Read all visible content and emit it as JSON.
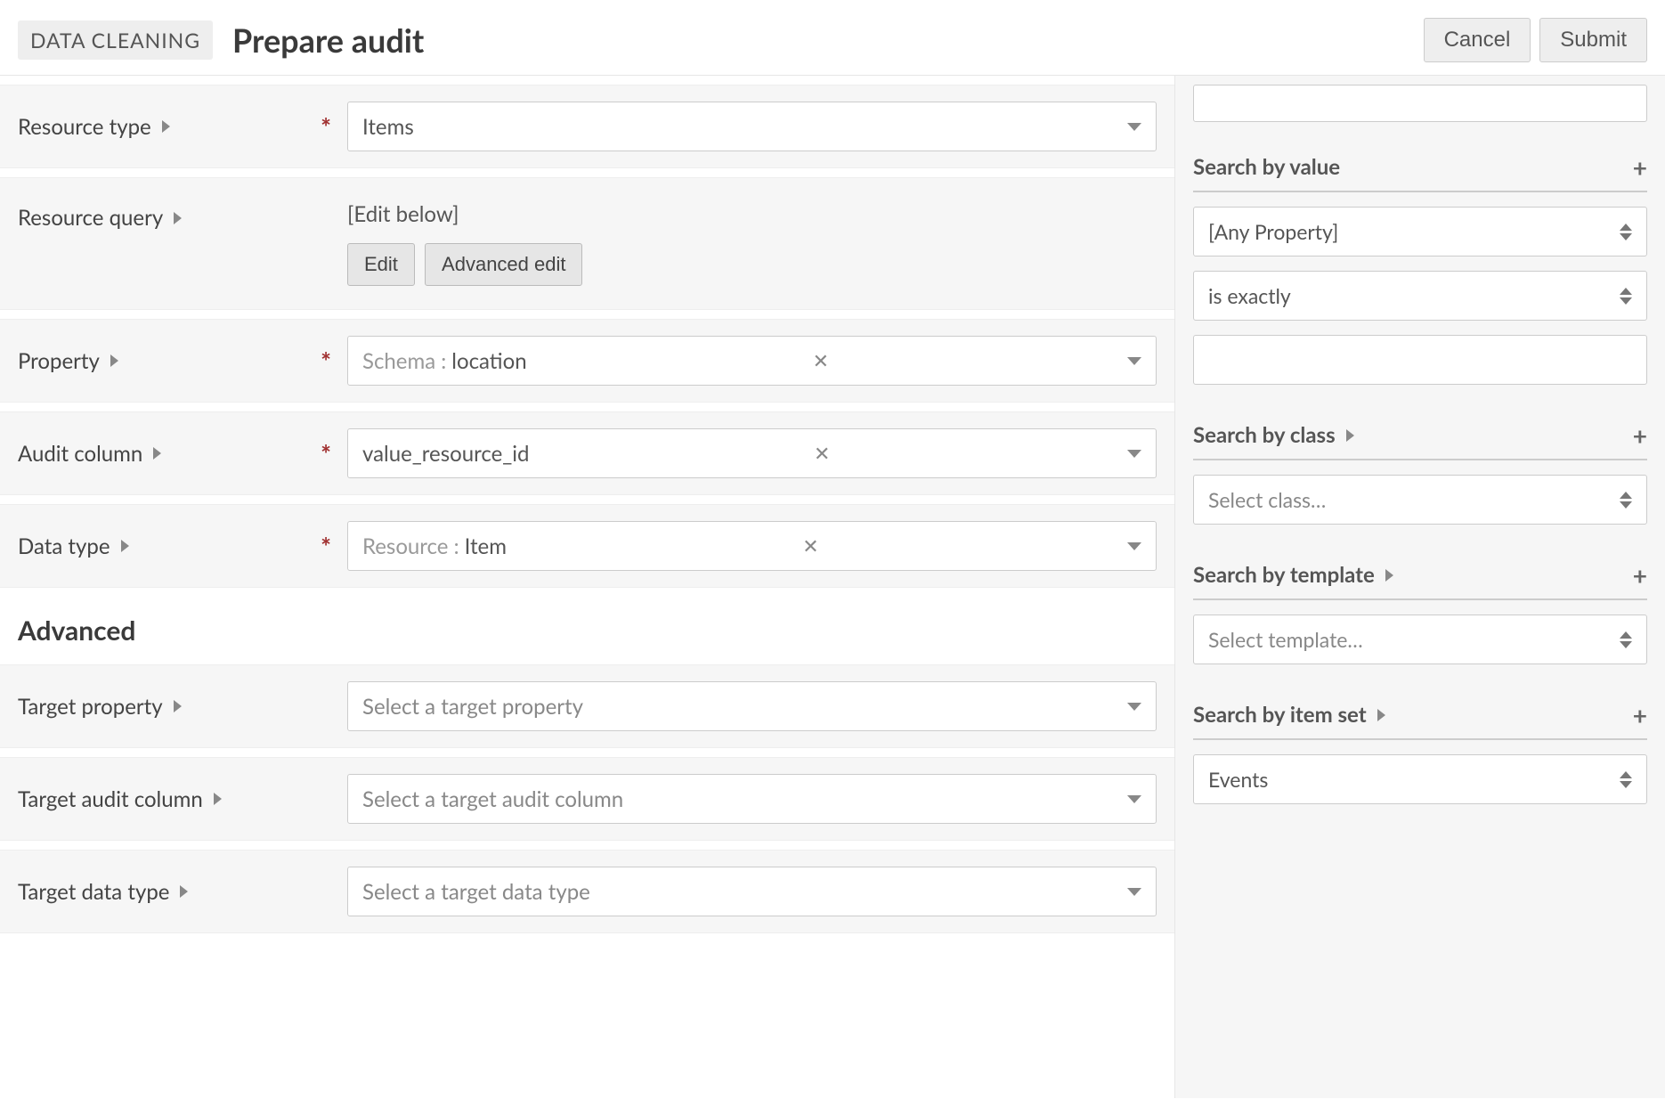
{
  "header": {
    "breadcrumb": "DATA CLEANING",
    "title": "Prepare audit",
    "cancel": "Cancel",
    "submit": "Submit"
  },
  "form": {
    "resource_type": {
      "label": "Resource type",
      "value": "Items"
    },
    "resource_query": {
      "label": "Resource query",
      "hint": "[Edit below]",
      "edit_btn": "Edit",
      "advanced_btn": "Advanced edit"
    },
    "property": {
      "label": "Property",
      "prefix": "Schema :",
      "value": "location"
    },
    "audit_column": {
      "label": "Audit column",
      "value": "value_resource_id"
    },
    "data_type": {
      "label": "Data type",
      "prefix": "Resource :",
      "value": "Item"
    },
    "advanced_heading": "Advanced",
    "target_property": {
      "label": "Target property",
      "placeholder": "Select a target property"
    },
    "target_audit_column": {
      "label": "Target audit column",
      "placeholder": "Select a target audit column"
    },
    "target_data_type": {
      "label": "Target data type",
      "placeholder": "Select a target data type"
    }
  },
  "sidebar": {
    "search_value": {
      "title": "Search by value",
      "property": "[Any Property]",
      "operator": "is exactly",
      "text_value": ""
    },
    "search_class": {
      "title": "Search by class",
      "placeholder": "Select class…"
    },
    "search_template": {
      "title": "Search by template",
      "placeholder": "Select template…"
    },
    "search_item_set": {
      "title": "Search by item set",
      "value": "Events"
    }
  }
}
